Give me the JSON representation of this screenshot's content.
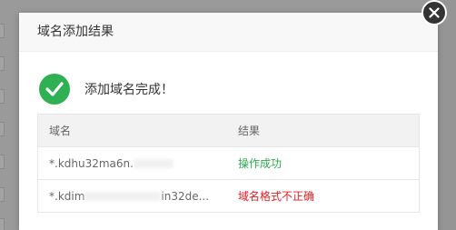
{
  "dialog": {
    "title": "域名添加结果",
    "result_message": "添加域名完成！",
    "colors": {
      "success": "#2fb052",
      "error": "#e02020"
    }
  },
  "table": {
    "columns": [
      "域名",
      "结果"
    ],
    "rows": [
      {
        "domain_prefix": "*.kdhu32ma6n.",
        "domain_suffix": "",
        "status": "操作成功",
        "status_type": "success"
      },
      {
        "domain_prefix": "*.kdim",
        "domain_suffix": "in32de...",
        "status": "域名格式不正确",
        "status_type": "error"
      }
    ]
  },
  "icons": {
    "close": "close-icon",
    "success": "checkmark-icon"
  }
}
